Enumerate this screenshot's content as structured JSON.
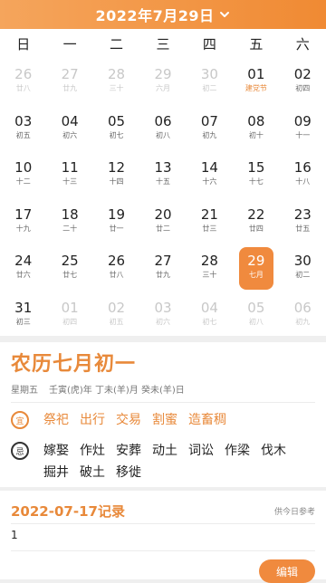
{
  "header": {
    "title": "2022年7月29日"
  },
  "weekdays": [
    "日",
    "一",
    "二",
    "三",
    "四",
    "五",
    "六"
  ],
  "days": [
    {
      "d": "26",
      "l": "廿八",
      "type": "other"
    },
    {
      "d": "27",
      "l": "廿九",
      "type": "other"
    },
    {
      "d": "28",
      "l": "三十",
      "type": "other"
    },
    {
      "d": "29",
      "l": "六月",
      "type": "other"
    },
    {
      "d": "30",
      "l": "初二",
      "type": "other"
    },
    {
      "d": "01",
      "l": "建党节",
      "type": "fest"
    },
    {
      "d": "02",
      "l": "初四",
      "type": ""
    },
    {
      "d": "03",
      "l": "初五",
      "type": ""
    },
    {
      "d": "04",
      "l": "初六",
      "type": ""
    },
    {
      "d": "05",
      "l": "初七",
      "type": ""
    },
    {
      "d": "06",
      "l": "初八",
      "type": ""
    },
    {
      "d": "07",
      "l": "初九",
      "type": ""
    },
    {
      "d": "08",
      "l": "初十",
      "type": ""
    },
    {
      "d": "09",
      "l": "十一",
      "type": ""
    },
    {
      "d": "10",
      "l": "十二",
      "type": ""
    },
    {
      "d": "11",
      "l": "十三",
      "type": ""
    },
    {
      "d": "12",
      "l": "十四",
      "type": ""
    },
    {
      "d": "13",
      "l": "十五",
      "type": ""
    },
    {
      "d": "14",
      "l": "十六",
      "type": ""
    },
    {
      "d": "15",
      "l": "十七",
      "type": ""
    },
    {
      "d": "16",
      "l": "十八",
      "type": ""
    },
    {
      "d": "17",
      "l": "十九",
      "type": ""
    },
    {
      "d": "18",
      "l": "二十",
      "type": ""
    },
    {
      "d": "19",
      "l": "廿一",
      "type": ""
    },
    {
      "d": "20",
      "l": "廿二",
      "type": ""
    },
    {
      "d": "21",
      "l": "廿三",
      "type": ""
    },
    {
      "d": "22",
      "l": "廿四",
      "type": ""
    },
    {
      "d": "23",
      "l": "廿五",
      "type": ""
    },
    {
      "d": "24",
      "l": "廿六",
      "type": ""
    },
    {
      "d": "25",
      "l": "廿七",
      "type": ""
    },
    {
      "d": "26",
      "l": "廿八",
      "type": ""
    },
    {
      "d": "27",
      "l": "廿九",
      "type": ""
    },
    {
      "d": "28",
      "l": "三十",
      "type": ""
    },
    {
      "d": "29",
      "l": "七月",
      "type": "sel"
    },
    {
      "d": "30",
      "l": "初二",
      "type": ""
    },
    {
      "d": "31",
      "l": "初三",
      "type": ""
    },
    {
      "d": "01",
      "l": "初四",
      "type": "other"
    },
    {
      "d": "02",
      "l": "初五",
      "type": "other"
    },
    {
      "d": "03",
      "l": "初六",
      "type": "other"
    },
    {
      "d": "04",
      "l": "初七",
      "type": "other"
    },
    {
      "d": "05",
      "l": "初八",
      "type": "other"
    },
    {
      "d": "06",
      "l": "初九",
      "type": "other"
    }
  ],
  "info": {
    "lunar_date": "农历七月初一",
    "weekday": "星期五",
    "ganzhi_year": "壬寅(虎)年",
    "ganzhi_month": "丁未(羊)月",
    "ganzhi_day": "癸未(羊)日",
    "yi_badge": "宜",
    "ji_badge": "忌",
    "yi": [
      "祭祀",
      "出行",
      "交易",
      "割蜜",
      "造畜稠"
    ],
    "ji": [
      "嫁娶",
      "作灶",
      "安葬",
      "动土",
      "词讼",
      "作梁",
      "伐木",
      "掘井",
      "破土",
      "移徙"
    ]
  },
  "record": {
    "title": "2022-07-17记录",
    "hint": "供今日参考",
    "content": "1",
    "edit_label": "编辑"
  },
  "colors": {
    "accent": "#f08a3e",
    "accent_text": "#e8893a"
  }
}
